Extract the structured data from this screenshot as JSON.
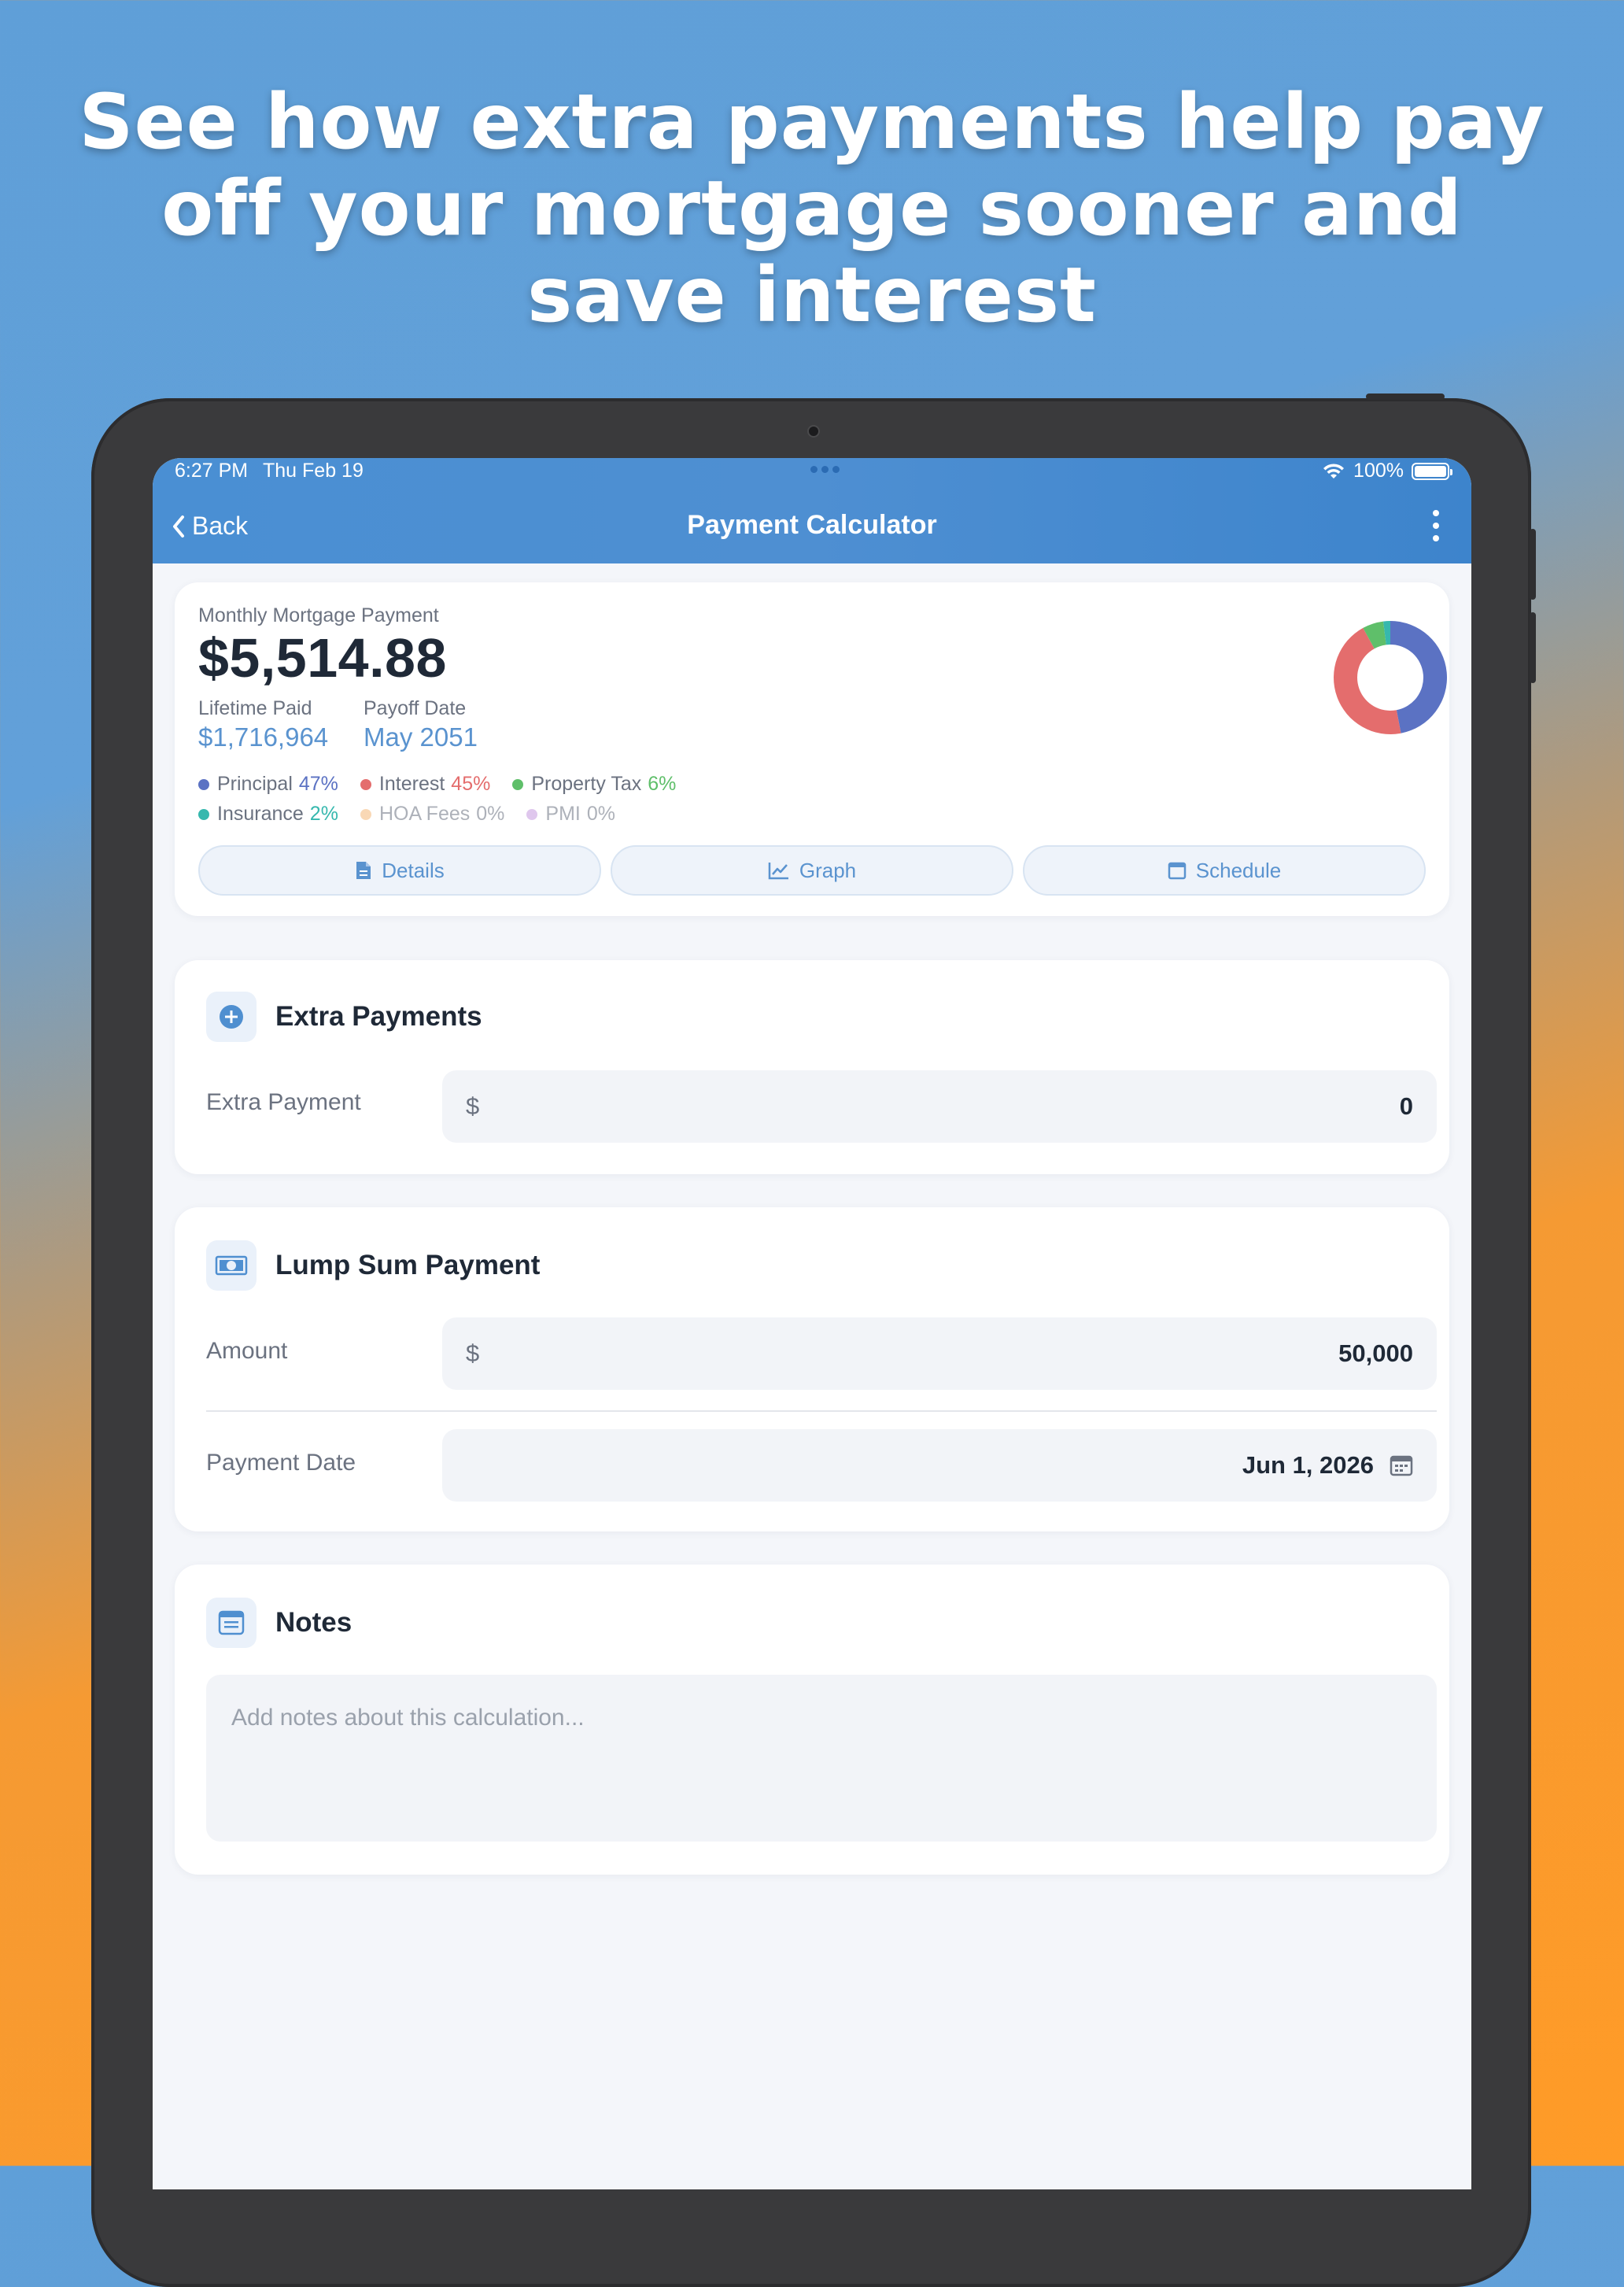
{
  "promo": {
    "headline_lines": [
      "See how extra payments help pay",
      "off your mortgage sooner and",
      "save interest"
    ]
  },
  "status_bar": {
    "time": "6:27 PM",
    "date": "Thu Feb 19",
    "battery": "100%"
  },
  "nav": {
    "back_label": "Back",
    "title": "Payment Calculator"
  },
  "summary": {
    "monthly_label": "Monthly Mortgage Payment",
    "monthly_value": "$5,514.88",
    "lifetime_label": "Lifetime Paid",
    "lifetime_value": "$1,716,964",
    "payoff_label": "Payoff Date",
    "payoff_value": "May 2051",
    "legend": [
      {
        "label": "Principal",
        "pct": "47%",
        "value": 47,
        "color": "#5b72c3"
      },
      {
        "label": "Interest",
        "pct": "45%",
        "value": 45,
        "color": "#e46d6d"
      },
      {
        "label": "Property Tax",
        "pct": "6%",
        "value": 6,
        "color": "#5fbf6a"
      },
      {
        "label": "Insurance",
        "pct": "2%",
        "value": 2,
        "color": "#36b8ae"
      },
      {
        "label": "HOA Fees",
        "pct": "0%",
        "value": 0,
        "color": "#f5b97a"
      },
      {
        "label": "PMI",
        "pct": "0%",
        "value": 0,
        "color": "#c59be0"
      }
    ],
    "buttons": {
      "details": "Details",
      "graph": "Graph",
      "schedule": "Schedule"
    }
  },
  "extra_payments": {
    "title": "Extra Payments",
    "field_label": "Extra Payment",
    "prefix": "$",
    "value": "0"
  },
  "lump_sum": {
    "title": "Lump Sum Payment",
    "amount_label": "Amount",
    "prefix": "$",
    "amount_value": "50,000",
    "date_label": "Payment Date",
    "date_value": "Jun 1, 2026"
  },
  "notes": {
    "title": "Notes",
    "placeholder": "Add notes about this calculation..."
  }
}
